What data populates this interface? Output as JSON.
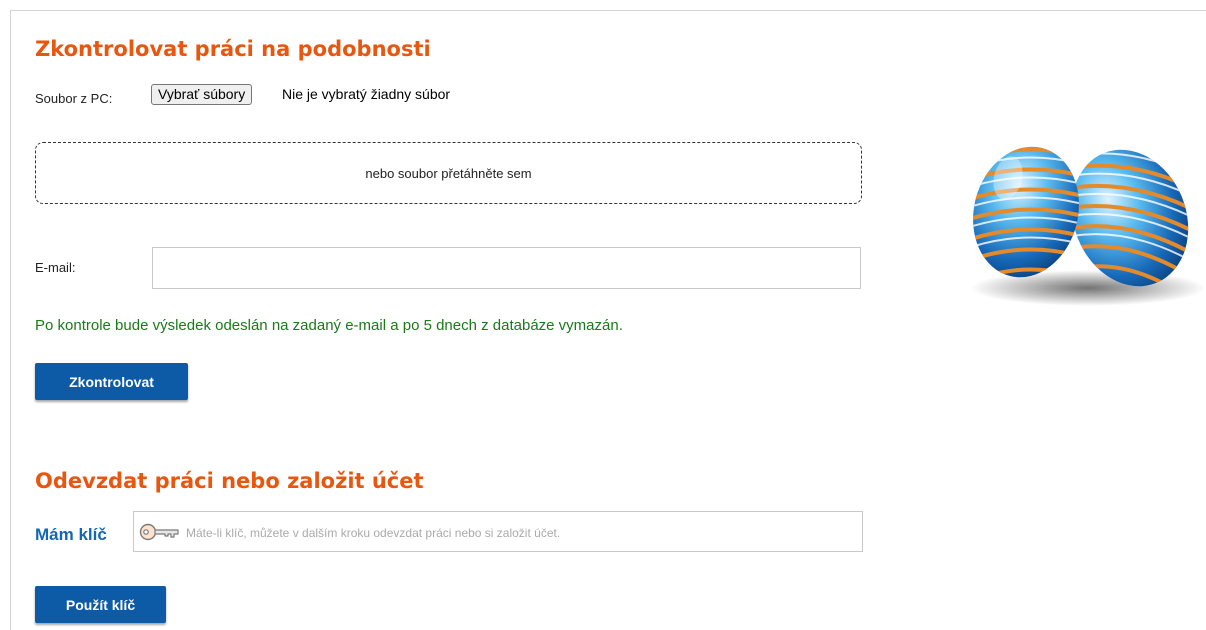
{
  "check_section": {
    "title": "Zkontrolovat práci na podobnosti",
    "file_label": "Soubor z PC:",
    "file_button_label": "Vybrať súbory",
    "file_status": "Nie je vybratý žiadny súbor",
    "dropzone_text": "nebo soubor přetáhněte sem",
    "email_label": "E-mail:",
    "email_value": "",
    "note": "Po kontrole bude výsledek odeslán na zadaný e-mail a po 5 dnech z databáze vymazán.",
    "submit_label": "Zkontrolovat"
  },
  "submit_section": {
    "title": "Odevzdat práci nebo založit účet",
    "key_label": "Mám klíč",
    "key_placeholder": "Máte-li klíč, můžete v dalším kroku odevzdat práci nebo si založit účet.",
    "key_value": "",
    "use_key_label": "Použít klíč"
  },
  "decoration": {
    "image": "easter-eggs"
  },
  "colors": {
    "heading": "#e8570f",
    "button": "#0d5aa7",
    "note": "#1a7a1a",
    "key_label": "#1467b3"
  }
}
